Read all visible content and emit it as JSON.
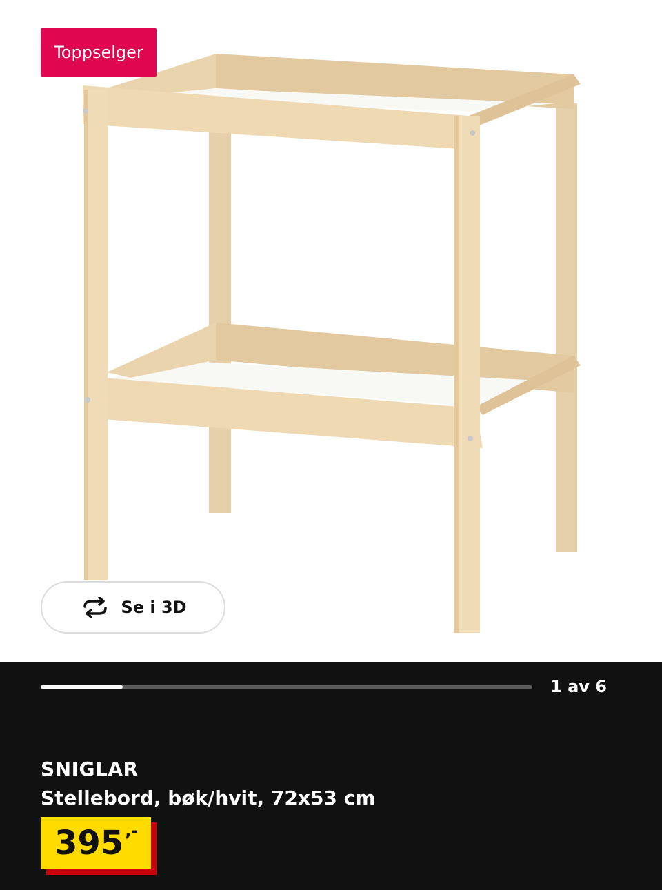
{
  "badge": {
    "label": "Toppselger",
    "color": "#e00751"
  },
  "view3d": {
    "label": "Se i 3D",
    "icon": "rotate-arrows-icon"
  },
  "gallery": {
    "counter": "1 av 6",
    "progress": 0.1667
  },
  "product": {
    "name": "SNIGLAR",
    "description": "Stellebord, bøk/hvit, 72x53 cm",
    "price": "395",
    "price_suffix": ",-",
    "price_color": "#ffdb00",
    "price_shadow_color": "#cc0008"
  }
}
